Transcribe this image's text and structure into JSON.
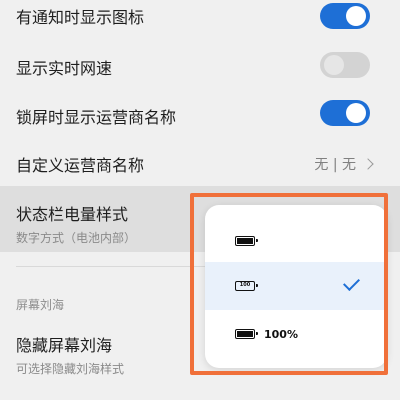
{
  "settings": {
    "notify_icon": {
      "title": "有通知时显示图标",
      "enabled": true
    },
    "realtime_speed": {
      "title": "显示实时网速",
      "enabled": false
    },
    "lock_carrier": {
      "title": "锁屏时显示运营商名称",
      "enabled": true
    },
    "custom_carrier": {
      "title": "自定义运营商名称",
      "value": "无 | 无"
    },
    "battery_style": {
      "title": "状态栏电量样式",
      "subtitle": "数字方式（电池内部）"
    },
    "notch_section": {
      "label": "屏幕刘海"
    },
    "hide_notch": {
      "title": "隐藏屏幕刘海",
      "subtitle": "可选择隐藏刘海样式"
    }
  },
  "popup": {
    "options": [
      {
        "icon": "battery-icon",
        "text": ""
      },
      {
        "icon": "battery-number-icon",
        "inner_text": "100",
        "selected": true
      },
      {
        "icon": "battery-icon",
        "text": "100%"
      }
    ]
  },
  "colors": {
    "accent": "#1e6fd6",
    "highlight_frame": "#f0703a"
  }
}
